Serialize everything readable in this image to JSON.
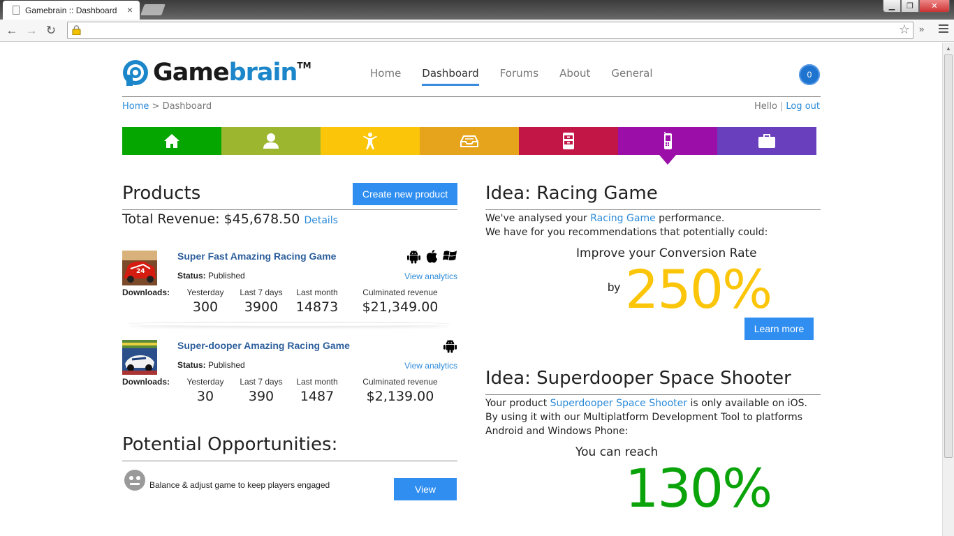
{
  "browser": {
    "tab_title": "Gamebrain :: Dashboard",
    "tab_close": "×",
    "back": "←",
    "forward": "→",
    "reload": "↻",
    "star": "☆",
    "more": "»",
    "win_min": "▁",
    "win_max": "❐",
    "win_close": "✕"
  },
  "brand": {
    "game": "Game",
    "brain": "brain",
    "tm": "TM",
    "accent": "#1b86c9"
  },
  "nav": {
    "items": [
      "Home",
      "Dashboard",
      "Forums",
      "About",
      "General"
    ],
    "active": "Dashboard"
  },
  "notifications": {
    "count": "0"
  },
  "breadcrumb": {
    "home": "Home",
    "sep": " > ",
    "current": "Dashboard"
  },
  "user": {
    "hello": "Hello",
    "sep": "|",
    "logout": "Log out"
  },
  "categories": [
    {
      "icon": "home-icon",
      "color": "#05a600"
    },
    {
      "icon": "user-icon",
      "color": "#9cb72f"
    },
    {
      "icon": "person-arms-up-icon",
      "color": "#fbc50a"
    },
    {
      "icon": "inbox-tray-icon",
      "color": "#e6a41c"
    },
    {
      "icon": "cabinet-icon",
      "color": "#c21646"
    },
    {
      "icon": "mobile-phone-icon",
      "color": "#9b0fa8",
      "active": true
    },
    {
      "icon": "briefcase-icon",
      "color": "#6a3fbe"
    }
  ],
  "products": {
    "heading": "Products",
    "create_label": "Create new product",
    "revenue_label": "Total Revenue: $45,678.50",
    "details_label": "Details",
    "status_label": "Status:",
    "analytics_label": "View analytics",
    "downloads_label": "Downloads:",
    "col_yesterday": "Yesterday",
    "col_week": "Last 7 days",
    "col_month": "Last month",
    "col_revenue": "Culminated revenue",
    "items": [
      {
        "name": "Super Fast Amazing Racing Game",
        "status": "Published",
        "platforms": [
          "android-icon",
          "apple-icon",
          "windows-icon"
        ],
        "yesterday": "300",
        "week": "3900",
        "month": "14873",
        "revenue": "$21,349.00"
      },
      {
        "name": "Super-dooper Amazing Racing Game",
        "status": "Published",
        "platforms": [
          "android-icon"
        ],
        "yesterday": "30",
        "week": "390",
        "month": "1487",
        "revenue": "$2,139.00"
      }
    ]
  },
  "potential": {
    "heading": "Potential Opportunities:",
    "item_text": "Balance & adjust game to keep players engaged",
    "view_label": "View"
  },
  "ideas": [
    {
      "title": "Idea: Racing Game",
      "line1_pre": "We've analysed your ",
      "line1_link": "Racing Game",
      "line1_post": " performance.",
      "line2": "We have for you recommendations that potentially could:",
      "improve": "Improve your Conversion Rate",
      "by": "by",
      "value": "250%",
      "value_color": "#fbc50a",
      "cta": "Learn more"
    },
    {
      "title": "Idea: Superdooper Space Shooter",
      "line1_pre": "Your product ",
      "line1_link": "Superdooper Space Shooter",
      "line1_post": " is only available on iOS.",
      "line2": "By using it with our Multiplatform Development Tool to platforms",
      "line3": "Android and Windows Phone:",
      "reach": "You can reach",
      "value": "130%",
      "value_color": "#0aa30a"
    }
  ]
}
